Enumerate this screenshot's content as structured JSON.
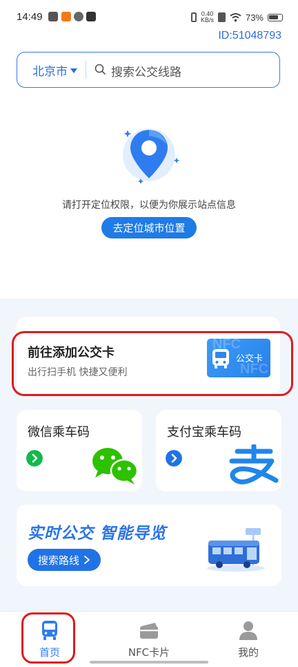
{
  "status_bar": {
    "time": "14:49",
    "net_speed_top": "0.40",
    "net_speed_unit": "KB/s",
    "battery": "73%"
  },
  "header": {
    "device_id": "ID:51048793"
  },
  "search": {
    "city": "北京市",
    "placeholder": "搜索公交线路"
  },
  "location_prompt": {
    "message": "请打开定位权限，以便为你展示站点信息",
    "button": "去定位城市位置"
  },
  "nfc_card": {
    "title": "前往添加公交卡",
    "subtitle": "出行扫手机 快捷又便利",
    "card_label": "公交卡",
    "watermark": "NFC"
  },
  "wechat_card": {
    "title": "微信乘车码",
    "accent": "#12b94c"
  },
  "alipay_card": {
    "title": "支付宝乘车码",
    "accent": "#1f73e6"
  },
  "realtime_card": {
    "title": "实时公交 智能导览",
    "button": "搜索路线"
  },
  "bottom_nav": {
    "items": [
      {
        "label": "首页",
        "icon": "bus-icon",
        "active": true
      },
      {
        "label": "NFC卡片",
        "icon": "card-icon",
        "active": false
      },
      {
        "label": "我的",
        "icon": "person-icon",
        "active": false
      }
    ]
  },
  "colors": {
    "primary": "#1f7be6",
    "highlight": "#dd1b1b",
    "background_lower": "#f1f5fc"
  }
}
